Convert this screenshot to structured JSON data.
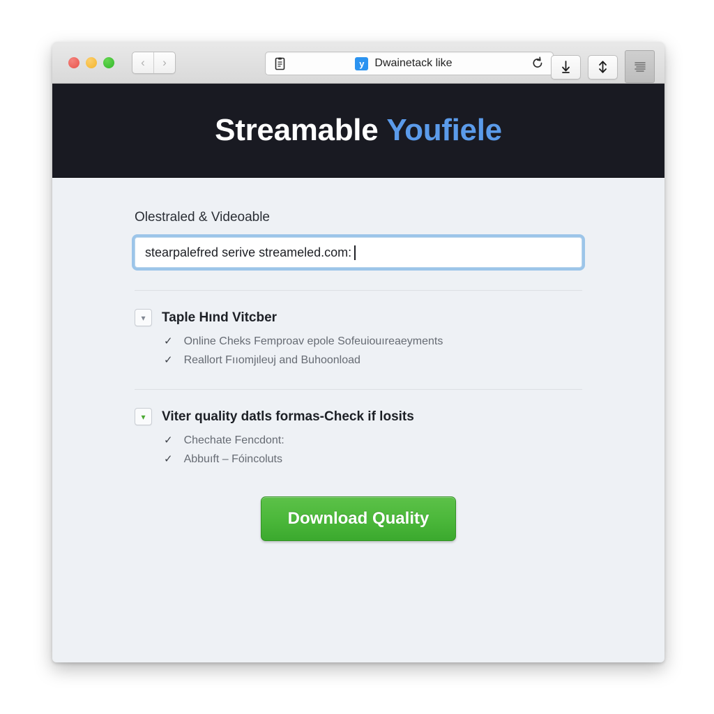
{
  "window": {
    "traffic_lights": [
      "close",
      "minimize",
      "zoom"
    ],
    "nav": {
      "back": "‹",
      "forward": "›"
    },
    "address_bar": {
      "reader_icon": "reader-icon",
      "favicon_letter": "y",
      "title": "Dwainetack like",
      "reload_icon": "↻"
    },
    "toolbar": {
      "download_icon": "download-arrow-icon",
      "share_icon": "share-arrow-icon",
      "sidebar_icon": "sidebar-list-icon"
    }
  },
  "hero": {
    "title_primary": "Streamable",
    "title_secondary": "Youfiele",
    "color_primary": "#ffffff",
    "color_secondary": "#5b9bea",
    "background": "#191a22"
  },
  "form": {
    "label": "Olestraled & Videoable",
    "input_value": "stearpalefred serive streameled.com:",
    "input_focus_color": "#9cc5e9"
  },
  "sections": [
    {
      "chevron": "▾",
      "chevron_color": "#808792",
      "title": "Taple Hınd Vitcber",
      "items": [
        "Online Cheks Femproav epole Sofeuiouıreaeyments",
        "Reallort Fııomјιleυј and Buhoonload"
      ]
    },
    {
      "chevron": "▾",
      "chevron_color": "#4aa832",
      "title": "Viter quality datls formas-Check if losits",
      "items": [
        "Chechate Fencdont:",
        "Abbuıft – Fóincoluts"
      ]
    }
  ],
  "checkmark": "✓",
  "action": {
    "download_label": "Download Quality",
    "color": "#4cb83b"
  }
}
